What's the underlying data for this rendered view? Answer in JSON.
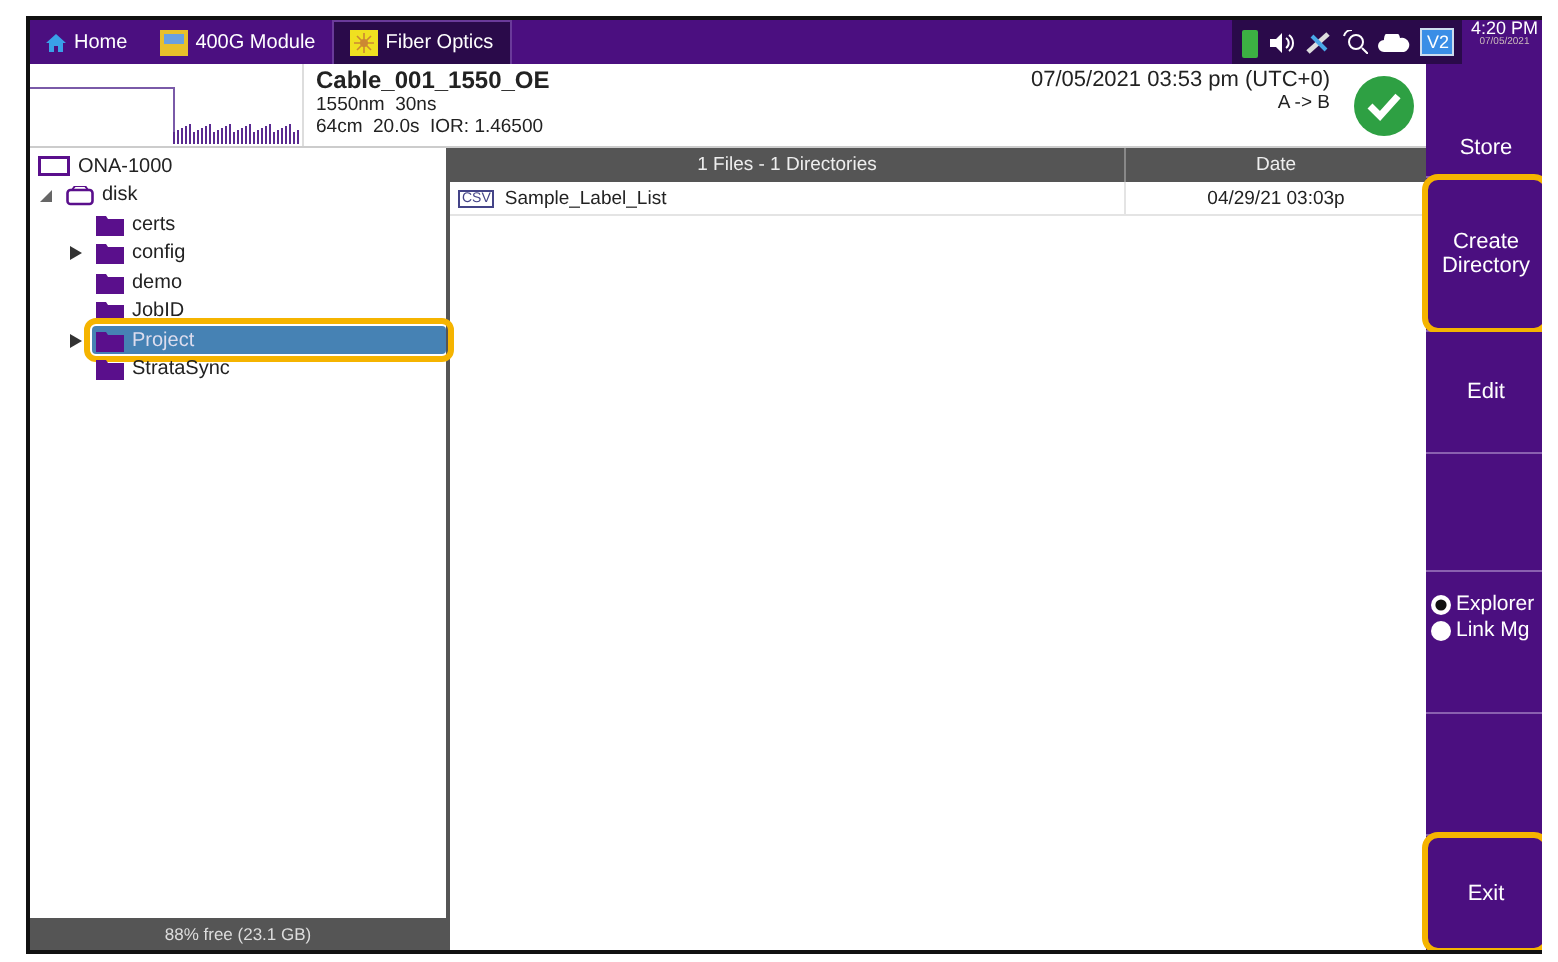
{
  "tabs": [
    {
      "label": "Home",
      "kind": "home",
      "selected": false
    },
    {
      "label": "400G Module",
      "kind": "module",
      "selected": false
    },
    {
      "label": "Fiber Optics",
      "kind": "fiber",
      "selected": true
    }
  ],
  "status": {
    "badge": "V2",
    "time": "4:20 PM",
    "date": "07/05/2021"
  },
  "result": {
    "name": "Cable_001_1550_OE",
    "line_1": "1550nm  30ns",
    "line_2": "64cm  20.0s  IOR: 1.46500",
    "datetime": "07/05/2021 03:53 pm (UTC+0)",
    "direction": "A -> B",
    "passed": true
  },
  "tree": {
    "label": "ONA-1000",
    "children": [
      {
        "label": "disk",
        "expanded": true,
        "selected": false,
        "children": [
          {
            "label": "certs",
            "selected": false
          },
          {
            "label": "config",
            "expanded": false,
            "selected": false
          },
          {
            "label": "demo",
            "selected": false
          },
          {
            "label": "JobID",
            "selected": false
          },
          {
            "label": "Project",
            "expanded": false,
            "selected": true,
            "highlighted": true
          },
          {
            "label": "StrataSync",
            "selected": false
          }
        ]
      }
    ]
  },
  "storage": "88% free (23.1 GB)",
  "file_list": {
    "columns": [
      "1 Files - 1 Directories",
      "Date"
    ],
    "rows": [
      {
        "type": "CSV",
        "name": "Sample_Label_List",
        "date": "04/29/21 03:03p",
        "selected": false
      }
    ]
  },
  "side_panel": [
    {
      "kind": "button",
      "label": "Store"
    },
    {
      "kind": "button",
      "label": "Create Directory",
      "highlighted": true
    },
    {
      "kind": "button",
      "label": "Edit"
    },
    {
      "kind": "blank"
    },
    {
      "kind": "radios",
      "options": [
        {
          "label": "Explorer",
          "selected": true
        },
        {
          "label": "Link Mg",
          "selected": false
        }
      ]
    },
    {
      "kind": "blank"
    },
    {
      "kind": "button",
      "label": "Exit",
      "highlighted": true
    }
  ]
}
